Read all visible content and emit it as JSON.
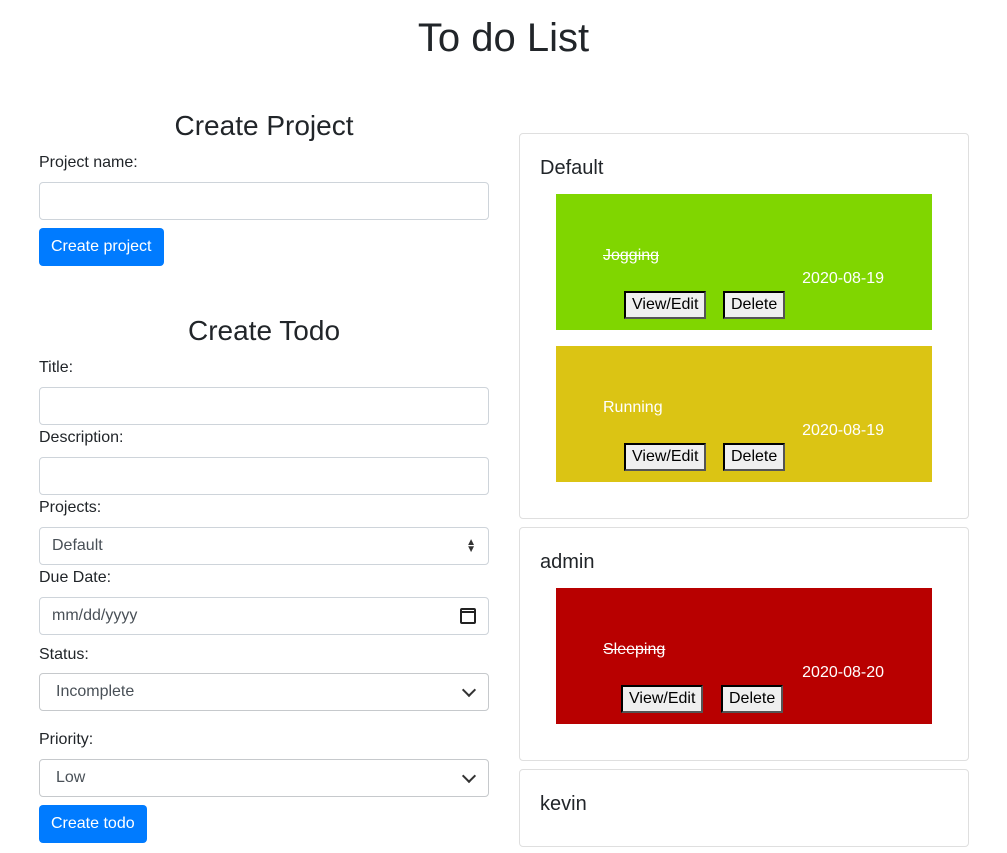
{
  "page": {
    "title": "To do List"
  },
  "create_project": {
    "heading": "Create Project",
    "name_label": "Project name:",
    "name_value": "",
    "button": "Create project"
  },
  "create_todo": {
    "heading": "Create Todo",
    "title_label": "Title:",
    "description_label": "Description:",
    "projects_label": "Projects:",
    "projects_selected": "Default",
    "due_label": "Due Date:",
    "due_placeholder": "mm/dd/yyyy",
    "status_label": "Status:",
    "status_selected": "Incomplete",
    "priority_label": "Priority:",
    "priority_selected": "Low",
    "button": "Create todo"
  },
  "projects": [
    {
      "name": "Default",
      "todos": [
        {
          "title": "Jogging",
          "date": "2020-08-19",
          "done": true,
          "color": "#80d600",
          "view_label": "View/Edit",
          "delete_label": "Delete"
        },
        {
          "title": "Running",
          "date": "2020-08-19",
          "done": false,
          "color": "#dbc414",
          "view_label": "View/Edit",
          "delete_label": "Delete"
        }
      ]
    },
    {
      "name": "admin",
      "todos": [
        {
          "title": "Sleeping",
          "date": "2020-08-20",
          "done": true,
          "color": "#b80000",
          "view_label": "View/Edit",
          "delete_label": "Delete"
        }
      ]
    },
    {
      "name": "kevin",
      "todos": []
    }
  ],
  "colors": {
    "primary": "#007bff"
  }
}
